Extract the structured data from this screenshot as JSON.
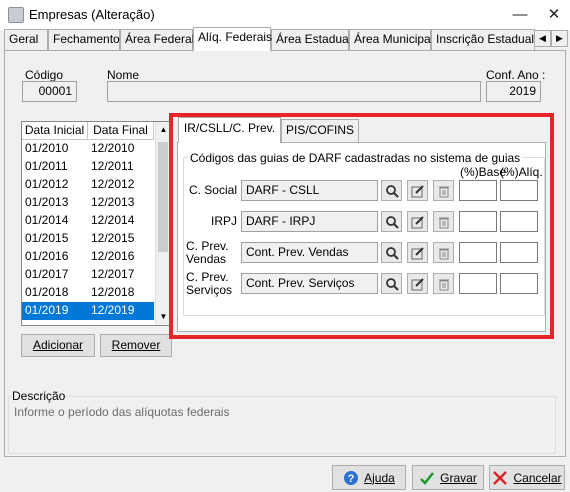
{
  "window": {
    "title": "Empresas (Alteração)",
    "minimize": "—",
    "close": "✕"
  },
  "tabs": [
    "Geral",
    "Fechamento",
    "Área Federal",
    "Alíq. Federais",
    "Área Estadual",
    "Área Municipal",
    "Inscrição Estadual S"
  ],
  "active_tab": "Alíq. Federais",
  "header": {
    "codigo_label": "Código",
    "codigo_value": "00001",
    "nome_label": "Nome",
    "nome_value": "",
    "conf_ano_label": "Conf. Ano :",
    "conf_ano_value": "2019"
  },
  "periods": {
    "columns": [
      "Data Inicial",
      "Data Final"
    ],
    "rows": [
      [
        "01/2010",
        "12/2010"
      ],
      [
        "01/2011",
        "12/2011"
      ],
      [
        "01/2012",
        "12/2012"
      ],
      [
        "01/2013",
        "12/2013"
      ],
      [
        "01/2014",
        "12/2014"
      ],
      [
        "01/2015",
        "12/2015"
      ],
      [
        "01/2016",
        "12/2016"
      ],
      [
        "01/2017",
        "12/2017"
      ],
      [
        "01/2018",
        "12/2018"
      ],
      [
        "01/2019",
        "12/2019"
      ]
    ],
    "selected_index": 9,
    "add_button": "Adicionar",
    "remove_button": "Remover"
  },
  "inner_tabs": [
    "IR/CSLL/C. Prev.",
    "PIS/COFINS"
  ],
  "darf": {
    "group_title": "Códigos das guias de DARF cadastradas no sistema de guias",
    "col_base": "(%)Base",
    "col_aliq": "(%)Alíq.",
    "rows": [
      {
        "label": "C. Social",
        "value": "DARF - CSLL"
      },
      {
        "label": "IRPJ",
        "value": "DARF - IRPJ"
      },
      {
        "label": "C. Prev. Vendas",
        "value": "Cont. Prev. Vendas"
      },
      {
        "label": "C. Prev. Serviços",
        "value": "Cont. Prev. Serviços"
      }
    ]
  },
  "descricao": {
    "label": "Descrição",
    "text": "Informe o período das alíquotas federais"
  },
  "footer": {
    "help": "Ajuda",
    "save": "Gravar",
    "cancel": "Cancelar"
  },
  "colors": {
    "highlight": "#e8242b",
    "selection": "#0078d7"
  }
}
